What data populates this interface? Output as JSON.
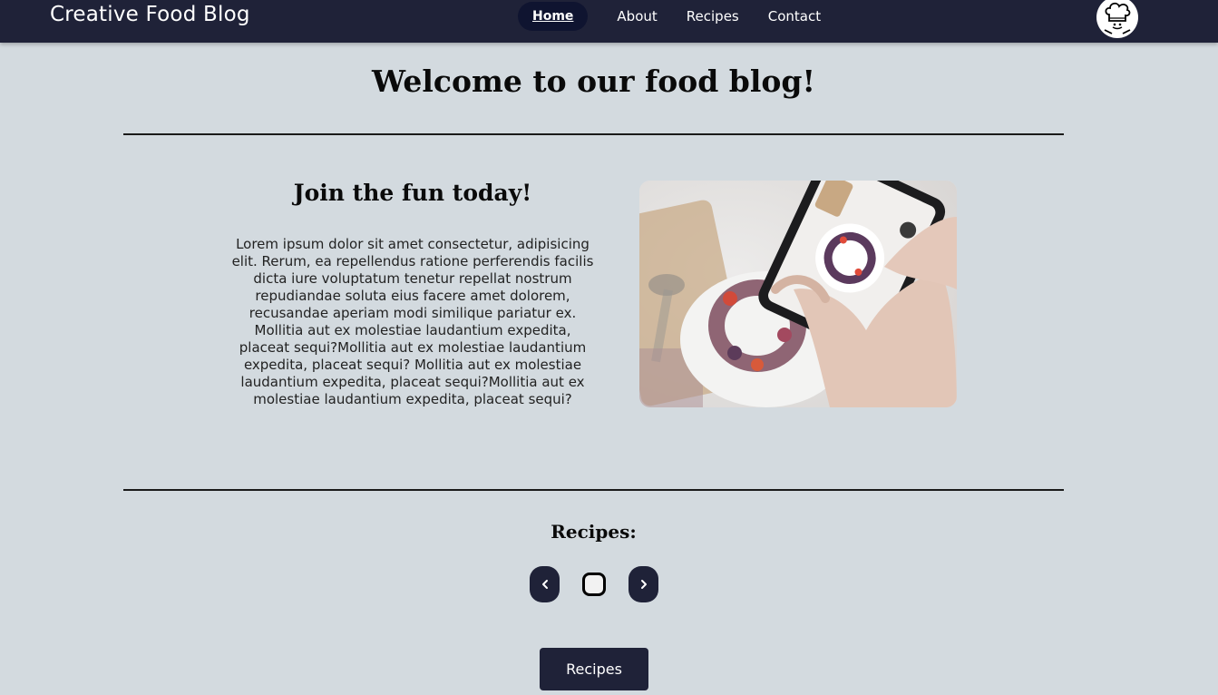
{
  "header": {
    "brand": "Creative Food Blog",
    "nav": [
      {
        "label": "Home",
        "active": true
      },
      {
        "label": "About",
        "active": false
      },
      {
        "label": "Recipes",
        "active": false
      },
      {
        "label": "Contact",
        "active": false
      }
    ],
    "avatar_icon": "chef-hat-icon"
  },
  "main": {
    "title": "Welcome to our food blog!",
    "intro": {
      "heading": "Join the fun today!",
      "body": "Lorem ipsum dolor sit amet consectetur, adipisicing elit. Rerum, ea repellendus ratione perferendis facilis dicta iure voluptatum tenetur repellat nostrum repudiandae soluta eius facere amet dolorem, recusandae aperiam modi similique pariatur ex. Mollitia aut ex molestiae laudantium expedita, placeat sequi?Mollitia aut ex molestiae laudantium expedita, placeat sequi? Mollitia aut ex molestiae laudantium expedita, placeat sequi?Mollitia aut ex molestiae laudantium expedita, placeat sequi?",
      "image_icon": "phone-photographing-cake-image"
    },
    "recipes": {
      "heading": "Recipes:",
      "prev_icon": "chevron-left-icon",
      "next_icon": "chevron-right-icon",
      "button_label": "Recipes"
    }
  },
  "colors": {
    "navbar": "#1f2238",
    "background": "#d3dadf",
    "button": "#1f2238"
  }
}
